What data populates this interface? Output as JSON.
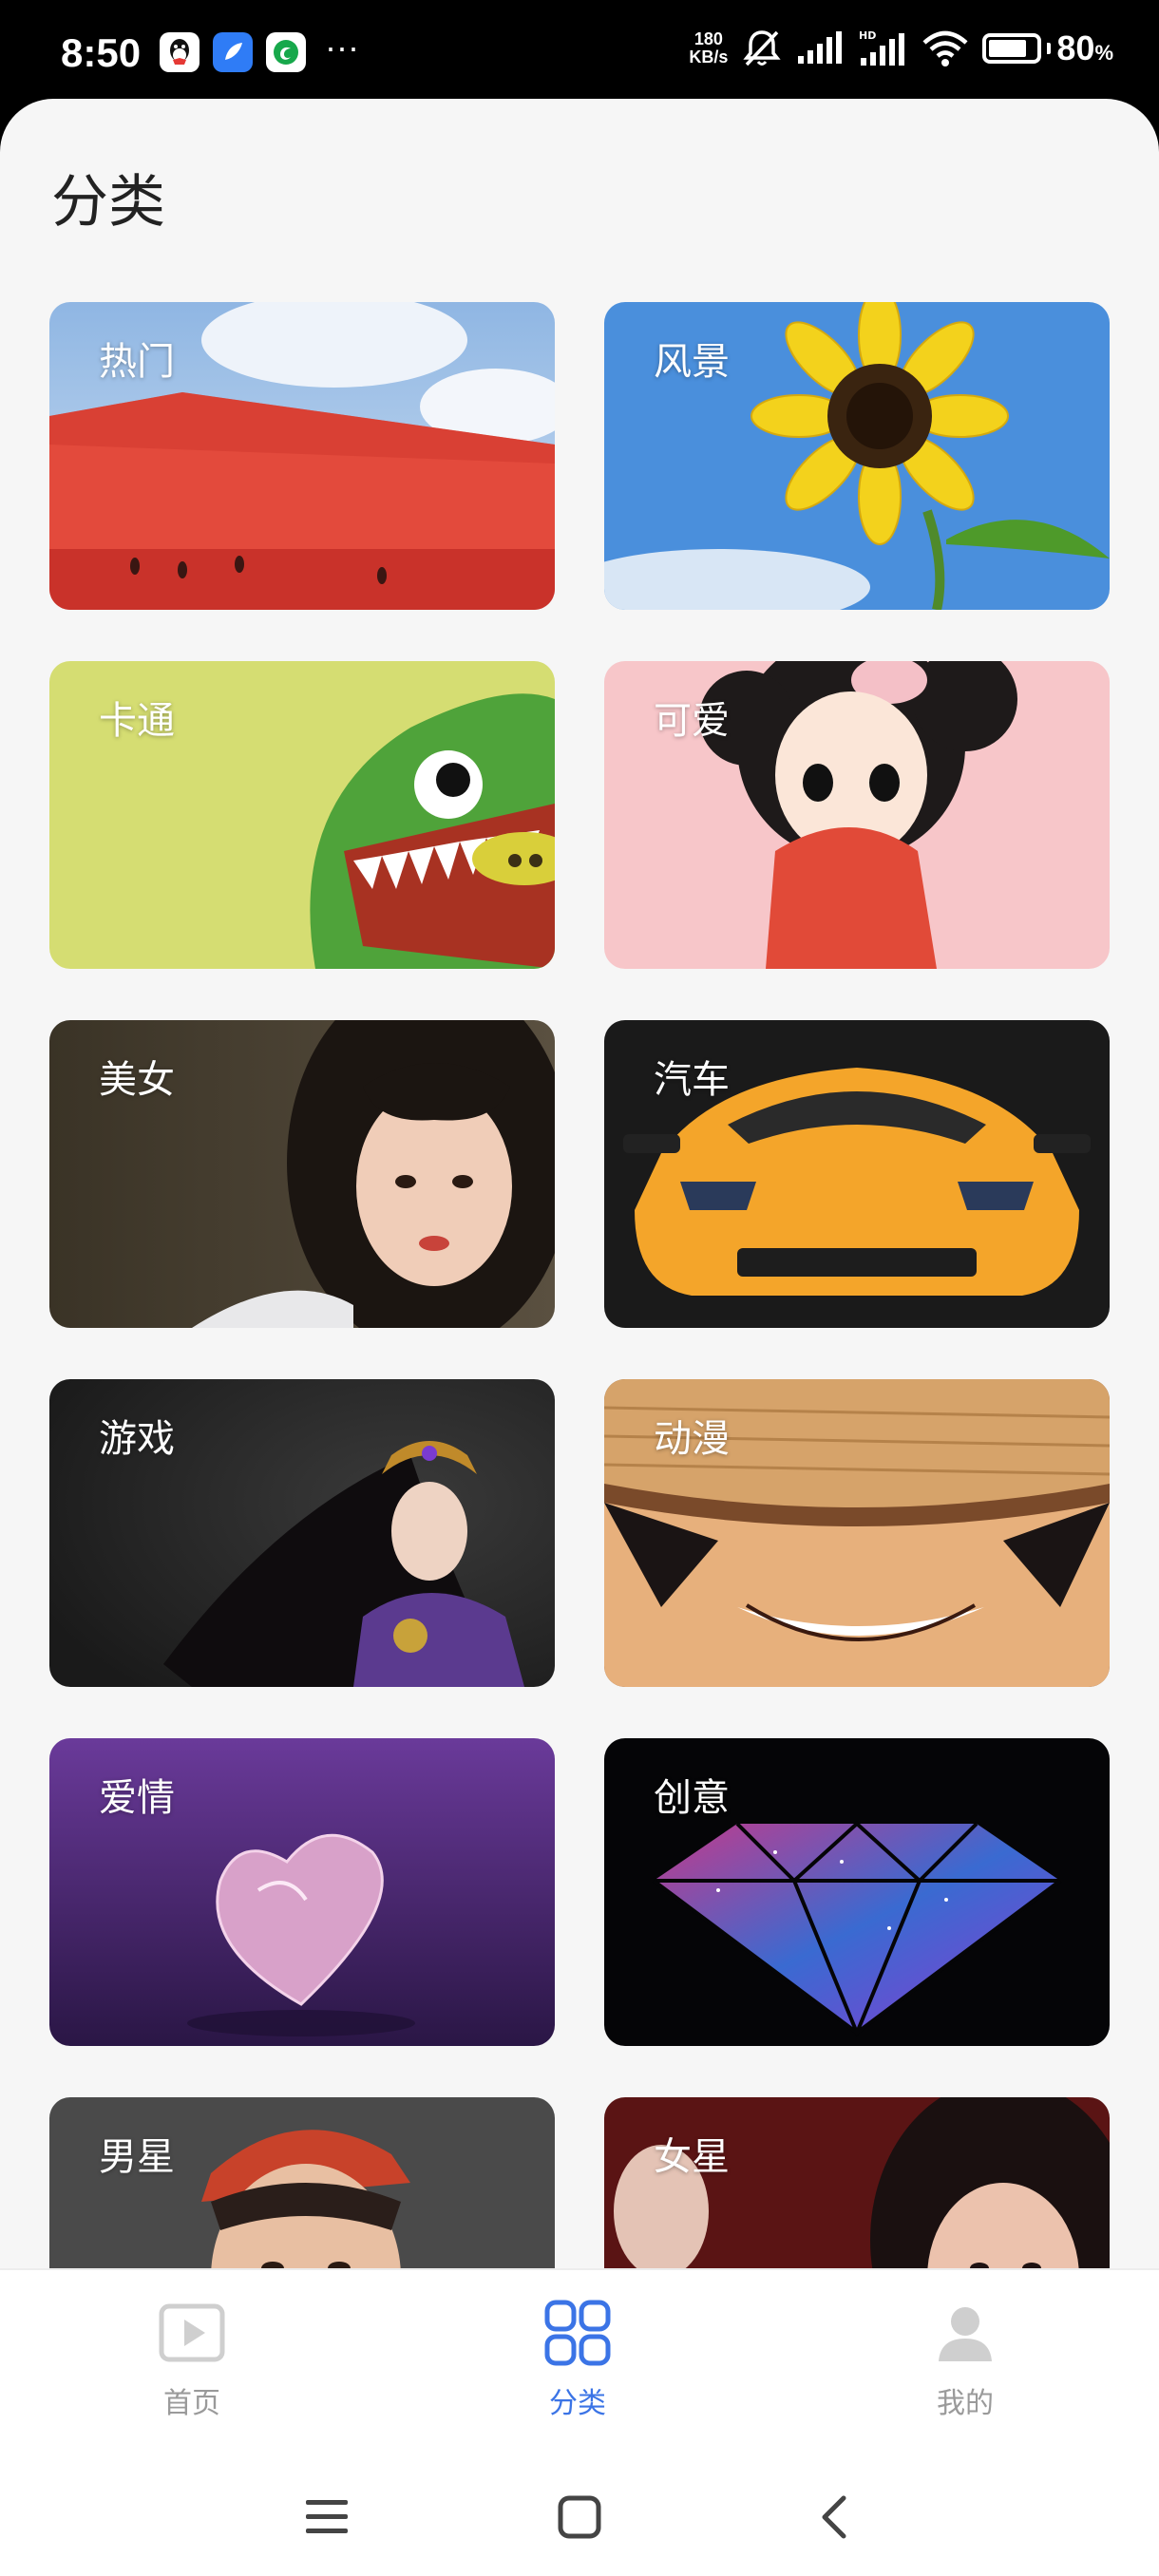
{
  "status_bar": {
    "time": "8:50",
    "net_speed_value": "180",
    "net_speed_unit": "KB/s",
    "battery_value": "80",
    "battery_unit": "%",
    "battery_level": 0.8,
    "dots": "···"
  },
  "page": {
    "title": "分类"
  },
  "categories": [
    {
      "label": "热门",
      "icon": "watermelon-image"
    },
    {
      "label": "风景",
      "icon": "sunflower-image"
    },
    {
      "label": "卡通",
      "icon": "cartoon-monster-image"
    },
    {
      "label": "可爱",
      "icon": "cute-girl-image"
    },
    {
      "label": "美女",
      "icon": "woman-portrait-image"
    },
    {
      "label": "汽车",
      "icon": "sports-car-image"
    },
    {
      "label": "游戏",
      "icon": "game-character-image"
    },
    {
      "label": "动漫",
      "icon": "anime-character-image"
    },
    {
      "label": "爱情",
      "icon": "crystal-heart-image"
    },
    {
      "label": "创意",
      "icon": "galaxy-diamond-image"
    },
    {
      "label": "男星",
      "icon": "male-star-image"
    },
    {
      "label": "女星",
      "icon": "female-star-image"
    }
  ],
  "bottom_nav": {
    "home": {
      "label": "首页",
      "icon": "play-icon"
    },
    "category": {
      "label": "分类",
      "icon": "grid-icon"
    },
    "mine": {
      "label": "我的",
      "icon": "person-icon"
    },
    "active": "category",
    "active_color": "#3b74e6",
    "inactive_color": "#9a9a9a"
  }
}
